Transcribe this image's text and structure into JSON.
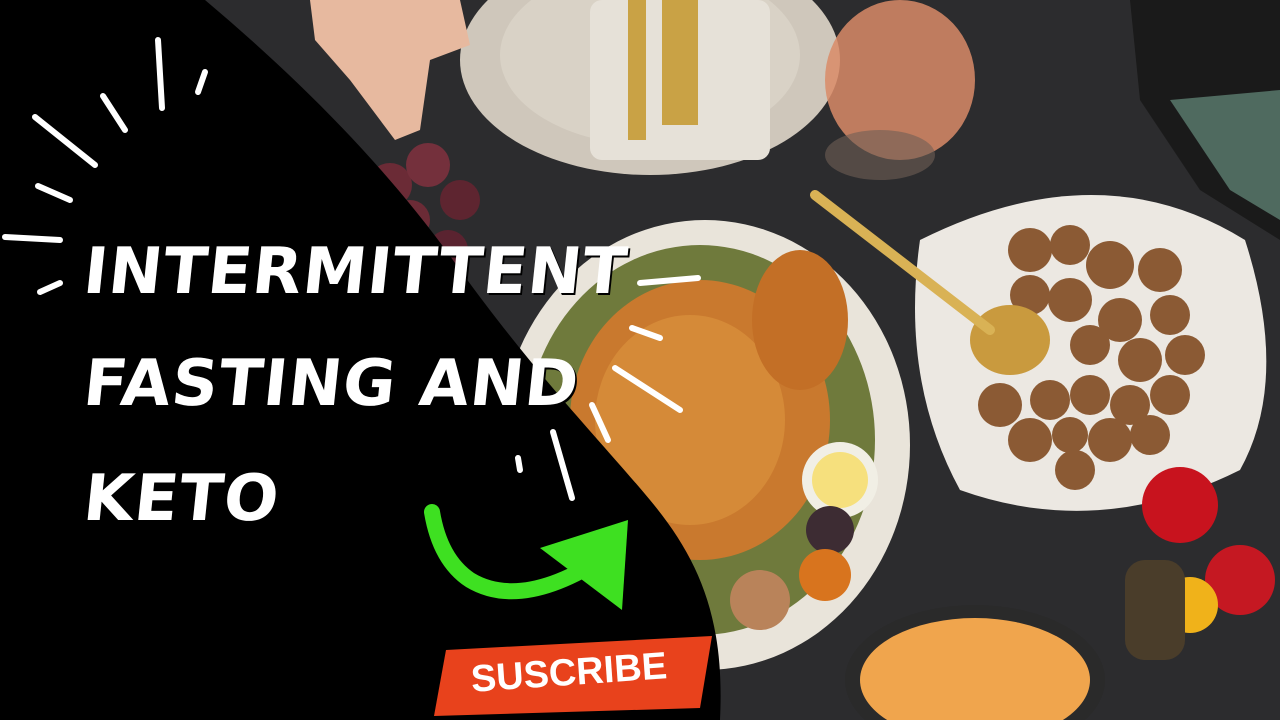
{
  "title": {
    "line1": "INTERMITTENT",
    "line2": "FASTING AND",
    "line3": "KETO"
  },
  "subscribe": {
    "label": "SUSCRIBE",
    "color": "#e8421c"
  },
  "colors": {
    "panel": "#000000",
    "tablecloth": "#2b2b2c",
    "arrow": "#3ee021",
    "text": "#ffffff"
  },
  "icons": [
    "burst-lines",
    "curved-arrow-icon"
  ]
}
